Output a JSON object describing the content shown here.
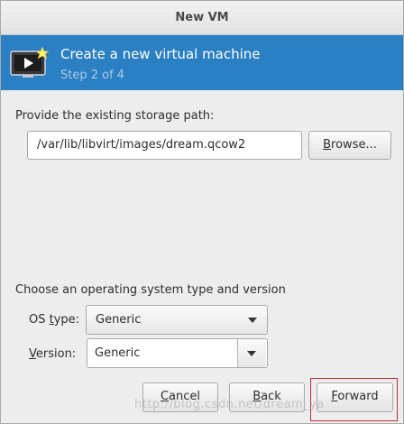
{
  "window": {
    "title": "New VM"
  },
  "header": {
    "title": "Create a new virtual machine",
    "step": "Step 2 of 4",
    "icon": "virtual-machine-monitor-icon"
  },
  "storage": {
    "label": "Provide the existing storage path:",
    "path_value": "/var/lib/libvirt/images/dream.qcow2",
    "browse_button": {
      "accel": "B",
      "rest": "rowse..."
    }
  },
  "os": {
    "section_label": "Choose an operating system type and version",
    "type_label": {
      "prefix": "OS ",
      "accel": "t",
      "rest": "ype:"
    },
    "type_value": "Generic",
    "version_label": {
      "accel": "V",
      "rest": "ersion:"
    },
    "version_value": "Generic"
  },
  "buttons": {
    "cancel": {
      "accel": "C",
      "rest": "ancel"
    },
    "back": {
      "accel": "B",
      "rest": "ack"
    },
    "forward": {
      "accel": "F",
      "rest": "orward"
    }
  },
  "watermark": "http://blog.csdn.net/dream_ya",
  "colors": {
    "header_bg": "#2b80c4",
    "step_text": "#a8cbe8",
    "highlight_border": "#c0303a"
  }
}
